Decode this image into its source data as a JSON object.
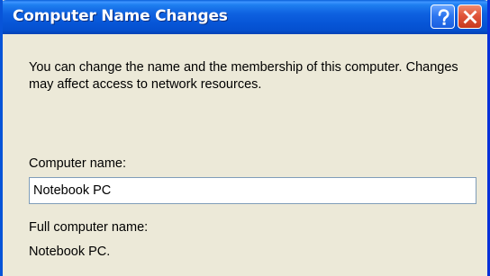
{
  "window": {
    "title": "Computer Name Changes",
    "help_button_icon": "help-icon",
    "close_button_icon": "close-icon"
  },
  "dialog": {
    "description": "You can change the name and the membership of this computer. Changes may affect access to network resources.",
    "computer_name_label": "Computer name:",
    "computer_name_value": "Notebook PC",
    "full_name_label": "Full computer name:",
    "full_name_value": "Notebook PC."
  },
  "colors": {
    "titlebar": "#0a5fd8",
    "dialog_background": "#ece9d8",
    "close_button": "#e0553a",
    "help_button": "#2d76f0",
    "input_border": "#7f9db9"
  }
}
